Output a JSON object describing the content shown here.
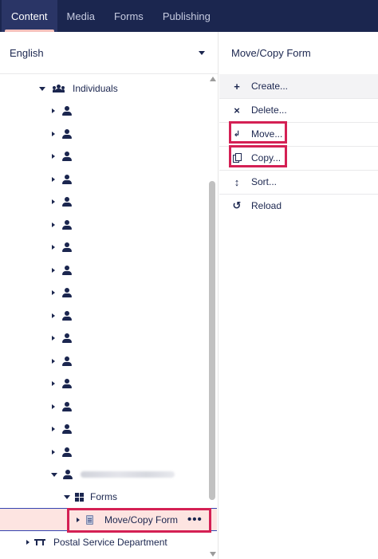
{
  "topnav": {
    "tabs": [
      {
        "label": "Content",
        "active": true
      },
      {
        "label": "Media",
        "active": false
      },
      {
        "label": "Forms",
        "active": false
      },
      {
        "label": "Publishing",
        "active": false
      }
    ]
  },
  "language": {
    "selected": "English"
  },
  "tree": {
    "individuals_label": "Individuals",
    "user_count": 17,
    "forms_label": "Forms",
    "selected_item_label": "Move/Copy Form",
    "postal_label": "Postal Service Department"
  },
  "actions_panel": {
    "title": "Move/Copy Form",
    "items": [
      {
        "label": "Create...",
        "icon": "plus-icon"
      },
      {
        "label": "Delete...",
        "icon": "close-icon"
      },
      {
        "label": "Move...",
        "icon": "move-icon"
      },
      {
        "label": "Copy...",
        "icon": "copy-icon"
      },
      {
        "label": "Sort...",
        "icon": "sort-icon"
      },
      {
        "label": "Reload",
        "icon": "reload-icon"
      }
    ]
  },
  "colors": {
    "nav_bg": "#1b264f",
    "text": "#1b264f",
    "highlight_box": "#d42054",
    "selected_bg": "#fde4e1"
  }
}
